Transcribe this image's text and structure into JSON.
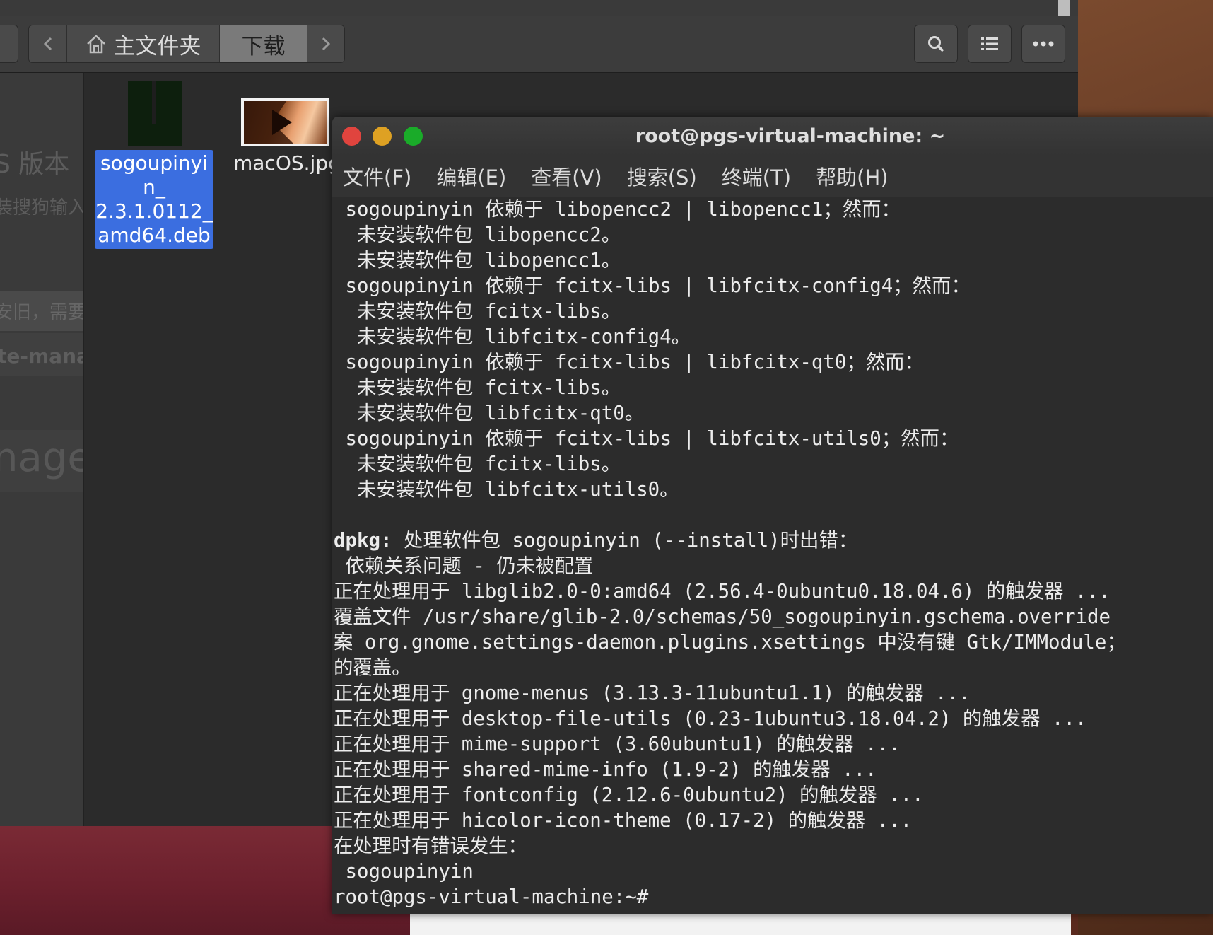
{
  "file_manager": {
    "breadcrumbs": [
      "主文件夹",
      "下载"
    ],
    "active_crumb": "下载",
    "toolbar_icons": [
      "search-icon",
      "list-view-icon",
      "more-icon"
    ],
    "files": [
      {
        "name": "sogoupinyin_2.3.1.0112_amd64.deb",
        "label_lines": [
          "sogoupinyi",
          "n_",
          "2.3.1.0112_",
          "amd64.deb"
        ],
        "selected": true
      },
      {
        "name": "macOS.jpg",
        "label": "macOS.jpg",
        "selected": false
      }
    ],
    "sidebar_ghost_text": [
      "S 版本",
      "装搜狗输入",
      "安旧，需要",
      "te-mana",
      "nage"
    ]
  },
  "terminal": {
    "title": "root@pgs-virtual-machine: ~",
    "menu": [
      "文件(F)",
      "编辑(E)",
      "查看(V)",
      "搜索(S)",
      "终端(T)",
      "帮助(H)"
    ],
    "lines": [
      " sogoupinyin 依赖于 libopencc2 | libopencc1；然而：",
      "  未安装软件包 libopencc2。",
      "  未安装软件包 libopencc1。",
      " sogoupinyin 依赖于 fcitx-libs | libfcitx-config4；然而：",
      "  未安装软件包 fcitx-libs。",
      "  未安装软件包 libfcitx-config4。",
      " sogoupinyin 依赖于 fcitx-libs | libfcitx-qt0；然而：",
      "  未安装软件包 fcitx-libs。",
      "  未安装软件包 libfcitx-qt0。",
      " sogoupinyin 依赖于 fcitx-libs | libfcitx-utils0；然而：",
      "  未安装软件包 fcitx-libs。",
      "  未安装软件包 libfcitx-utils0。",
      "",
      "dpkg: 处理软件包 sogoupinyin (--install)时出错：",
      " 依赖关系问题 - 仍未被配置",
      "正在处理用于 libglib2.0-0:amd64 (2.56.4-0ubuntu0.18.04.6) 的触发器 ...",
      "覆盖文件 /usr/share/glib-2.0/schemas/50_sogoupinyin.gschema.override",
      "案 org.gnome.settings-daemon.plugins.xsettings 中没有键 Gtk/IMModule；",
      "的覆盖。",
      "正在处理用于 gnome-menus (3.13.3-11ubuntu1.1) 的触发器 ...",
      "正在处理用于 desktop-file-utils (0.23-1ubuntu3.18.04.2) 的触发器 ...",
      "正在处理用于 mime-support (3.60ubuntu1) 的触发器 ...",
      "正在处理用于 shared-mime-info (1.9-2) 的触发器 ...",
      "正在处理用于 fontconfig (2.12.6-0ubuntu2) 的触发器 ...",
      "正在处理用于 hicolor-icon-theme (0.17-2) 的触发器 ...",
      "在处理时有错误发生：",
      " sogoupinyin",
      "root@pgs-virtual-machine:~#"
    ],
    "colors": {
      "close": "#e0443e",
      "minimize": "#dea123",
      "maximize": "#1aab29",
      "bg": "#2c2c2c"
    }
  }
}
